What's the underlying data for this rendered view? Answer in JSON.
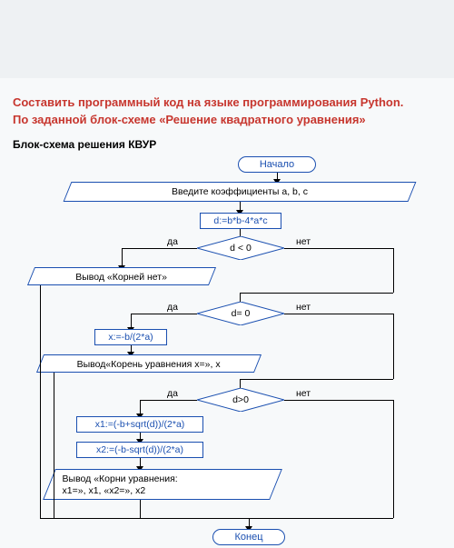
{
  "title_line1": "Составить программный код на языке программирования Python.",
  "title_line2": "По заданной блок-схеме «Решение квадратного уравнения»",
  "subtitle": "Блок-схема решения КВУР",
  "nodes": {
    "start": "Начало",
    "input": "Введите коэффициенты a, b, c",
    "calc_d": "d:=b*b-4*a*c",
    "dec_neg": "d < 0",
    "out_noroots": "Вывод «Корней нет»",
    "dec_zero": "d= 0",
    "calc_x": "x:=-b/(2*a)",
    "out_one": "Вывод«Корень уравнения x=», x",
    "dec_pos": "d>0",
    "calc_x1": "x1:=(-b+sqrt(d))/(2*a)",
    "calc_x2": "x2:=(-b-sqrt(d))/(2*a)",
    "out_two_l1": "Вывод «Корни уравнения:",
    "out_two_l2": "x1=», x1, «x2=», x2",
    "end": "Конец"
  },
  "labels": {
    "yes": "да",
    "no": "нет"
  },
  "chart_data": {
    "type": "flowchart",
    "title": "Решение квадратного уравнения",
    "nodes": [
      {
        "id": "start",
        "kind": "terminator",
        "text": "Начало"
      },
      {
        "id": "input",
        "kind": "io",
        "text": "Введите коэффициенты a, b, c"
      },
      {
        "id": "calc_d",
        "kind": "process",
        "text": "d:=b*b-4*a*c"
      },
      {
        "id": "dec_neg",
        "kind": "decision",
        "text": "d < 0"
      },
      {
        "id": "out_noroots",
        "kind": "io",
        "text": "Вывод «Корней нет»"
      },
      {
        "id": "dec_zero",
        "kind": "decision",
        "text": "d= 0"
      },
      {
        "id": "calc_x",
        "kind": "process",
        "text": "x:=-b/(2*a)"
      },
      {
        "id": "out_one",
        "kind": "io",
        "text": "Вывод«Корень уравнения x=», x"
      },
      {
        "id": "dec_pos",
        "kind": "decision",
        "text": "d>0"
      },
      {
        "id": "calc_x1",
        "kind": "process",
        "text": "x1:=(-b+sqrt(d))/(2*a)"
      },
      {
        "id": "calc_x2",
        "kind": "process",
        "text": "x2:=(-b-sqrt(d))/(2*a)"
      },
      {
        "id": "out_two",
        "kind": "io",
        "text": "Вывод «Корни уравнения: x1=», x1, «x2=», x2"
      },
      {
        "id": "end",
        "kind": "terminator",
        "text": "Конец"
      }
    ],
    "edges": [
      {
        "from": "start",
        "to": "input"
      },
      {
        "from": "input",
        "to": "calc_d"
      },
      {
        "from": "calc_d",
        "to": "dec_neg"
      },
      {
        "from": "dec_neg",
        "to": "out_noroots",
        "label": "да"
      },
      {
        "from": "dec_neg",
        "to": "dec_zero",
        "label": "нет"
      },
      {
        "from": "dec_zero",
        "to": "calc_x",
        "label": "да"
      },
      {
        "from": "calc_x",
        "to": "out_one"
      },
      {
        "from": "dec_zero",
        "to": "dec_pos",
        "label": "нет"
      },
      {
        "from": "dec_pos",
        "to": "calc_x1",
        "label": "да"
      },
      {
        "from": "calc_x1",
        "to": "calc_x2"
      },
      {
        "from": "calc_x2",
        "to": "out_two"
      },
      {
        "from": "out_noroots",
        "to": "end"
      },
      {
        "from": "out_one",
        "to": "end"
      },
      {
        "from": "out_two",
        "to": "end"
      },
      {
        "from": "dec_pos",
        "to": "end",
        "label": "нет"
      }
    ]
  }
}
